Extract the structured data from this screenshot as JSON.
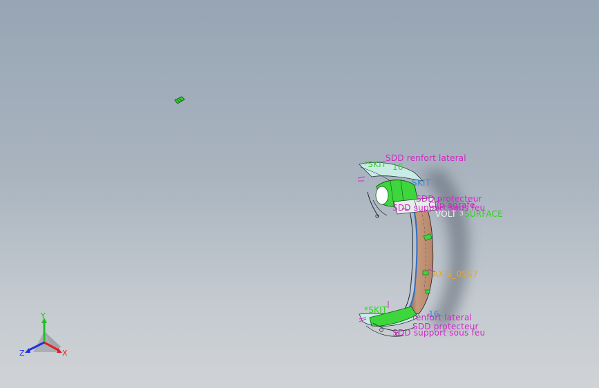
{
  "colors": {
    "annotation_magenta": "#d126c9",
    "annotation_green": "#33d11d",
    "annotation_blue": "#2f8bd4",
    "annotation_white": "#f2f2f2",
    "annotation_orange": "#e3a634",
    "body_tan": "#c49a7e",
    "surface_green": "#3dd63d",
    "surface_light": "#c8ece4",
    "axis_x": "#e02020",
    "axis_y": "#20c020",
    "axis_z": "#2030e0"
  },
  "annotations": {
    "renfort_top": "SDD renfort lateral",
    "sketch_top": "*SKIT",
    "sketch_top_num": "16",
    "blue_top": "SKIT",
    "protecteur_top": "SDD protecteur",
    "clip_top": "Clip agrafe",
    "support_top": "SDD support sous feu",
    "volt": "VOLT",
    "volt_num": "3",
    "surface": "SURFACE",
    "axis": "AXIS_0567",
    "sketch_bottom": "*SKIT",
    "sketch_bottom_num": "16",
    "renfort_bottom": "renfort lateral",
    "protecteur_bottom": "SDD protecteur",
    "support_bottom": "SDD support sous feu"
  },
  "triad": {
    "x_label": "X",
    "y_label": "Y",
    "z_label": "Z"
  }
}
